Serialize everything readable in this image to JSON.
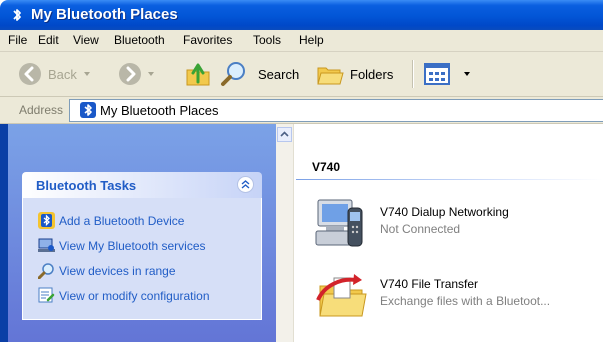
{
  "window": {
    "title": "My Bluetooth Places"
  },
  "menu": {
    "items": [
      {
        "label": "File"
      },
      {
        "label": "Edit"
      },
      {
        "label": "View"
      },
      {
        "label": "Bluetooth"
      },
      {
        "label": "Favorites"
      },
      {
        "label": "Tools"
      },
      {
        "label": "Help"
      }
    ]
  },
  "toolbar": {
    "back_label": "Back",
    "search_label": "Search",
    "folders_label": "Folders"
  },
  "address": {
    "label": "Address",
    "value": "My Bluetooth Places"
  },
  "tasks": {
    "title": "Bluetooth Tasks",
    "items": [
      {
        "label": "Add a Bluetooth Device",
        "icon": "add-device-icon"
      },
      {
        "label": "View My Bluetooth services",
        "icon": "services-icon"
      },
      {
        "label": "View devices in range",
        "icon": "search-devices-icon"
      },
      {
        "label": "View or modify configuration",
        "icon": "configuration-icon"
      }
    ]
  },
  "content": {
    "group_title": "V740",
    "items": [
      {
        "name": "V740 Dialup Networking",
        "status": "Not Connected",
        "icon": "dialup-networking-icon"
      },
      {
        "name": "V740 File Transfer",
        "status": "Exchange files with a Bluetoot...",
        "icon": "file-transfer-icon"
      }
    ]
  },
  "colors": {
    "title_bar": "#0255d6",
    "task_link": "#215dc6",
    "task_pane": "#6375d6",
    "chrome": "#ece9d8"
  }
}
